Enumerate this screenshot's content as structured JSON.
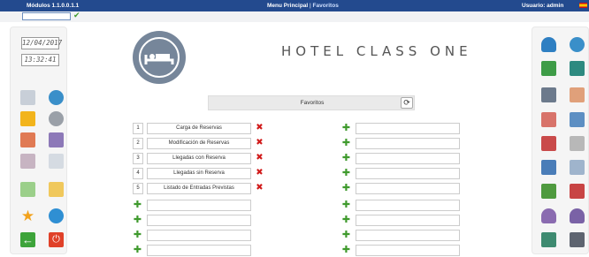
{
  "topbar": {
    "modules": "Módulos 1.1.0.0.1.1",
    "menu": "Menu Principal",
    "separator": " | ",
    "current": "Favoritos",
    "user": "Usuario: admin"
  },
  "clock": {
    "date": "12/04/2017",
    "time": "13:32:41"
  },
  "hotel_name": "HOTEL CLASS ONE",
  "favorites": {
    "title": "Favoritos",
    "left": [
      {
        "num": "1",
        "label": "Carga de Reservas"
      },
      {
        "num": "2",
        "label": "Modificación de Reservas"
      },
      {
        "num": "3",
        "label": "Llegadas con Reserva"
      },
      {
        "num": "4",
        "label": "Llegadas sin Reserva"
      },
      {
        "num": "5",
        "label": "Listado de Entradas Previstas"
      }
    ]
  },
  "colors": {
    "topbar": "#234a8e",
    "add": "#3f9a2d",
    "remove": "#d11a1a"
  },
  "left_icons": [
    "book-icon",
    "globe-icon",
    "folder-icon",
    "gears-icon",
    "calendar-edit-icon",
    "bed-icon",
    "calendar-grid-icon",
    "document-icon",
    "pencil-icon",
    "lock-icon",
    "star-icon",
    "clock-icon",
    "exit-icon",
    "power-icon"
  ],
  "right_icons": [
    "user-icon",
    "clock-icon",
    "money-icon",
    "network-icon",
    "people-icon",
    "calendar-icon",
    "calendar-edit-icon",
    "calendar-edit-icon",
    "calendar-edit-icon",
    "calendar-search-icon",
    "calendar-check-icon",
    "document-icon",
    "door-enter-icon",
    "door-exit-icon",
    "user-purple-icon",
    "user-purple-icon",
    "cash-register-icon",
    "printer-icon"
  ]
}
